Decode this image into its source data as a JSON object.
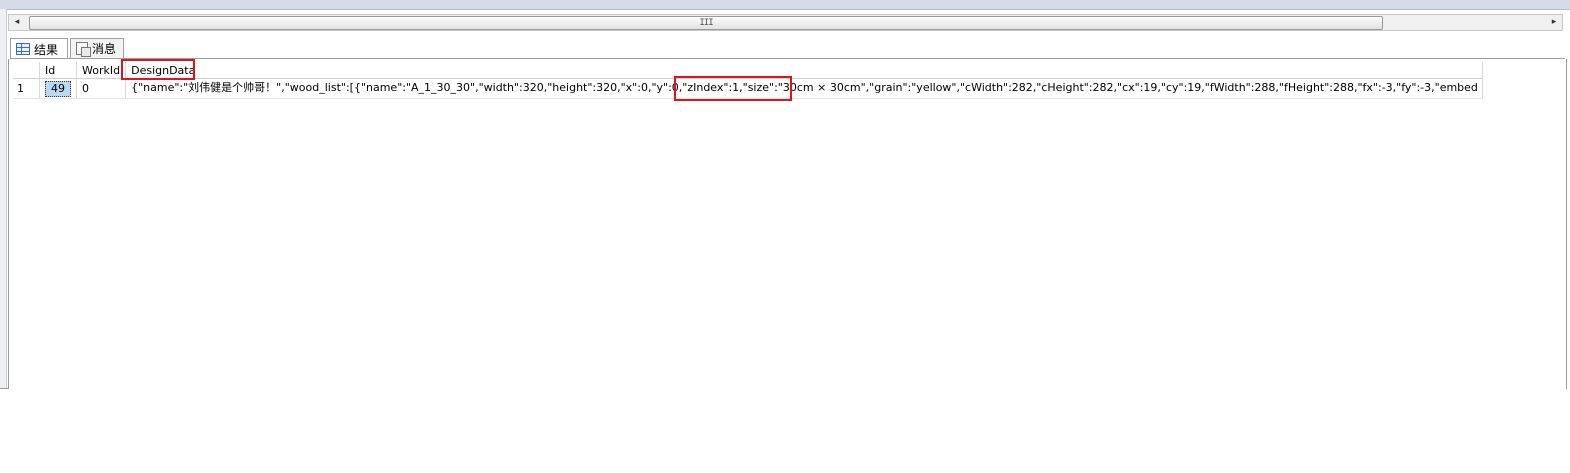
{
  "hscroll": {
    "left_arrow": "◂",
    "right_arrow": "▸",
    "grip": "III"
  },
  "tabs": [
    {
      "label": "结果",
      "icon": "grid-icon"
    },
    {
      "label": "消息",
      "icon": "message-icon"
    }
  ],
  "grid": {
    "columns": [
      "Id",
      "WorkId",
      "DesignData"
    ],
    "rows": [
      {
        "rownum": "1",
        "id": "49",
        "work_id": "0",
        "design_data": "{\"name\":\"刘伟健是个帅哥！\",\"wood_list\":[{\"name\":\"A_1_30_30\",\"width\":320,\"height\":320,\"x\":0,\"y\":0,\"zIndex\":1,\"size\":\"30cm × 30cm\",\"grain\":\"yellow\",\"cWidth\":282,\"cHeight\":282,\"cx\":19,\"cy\":19,\"fWidth\":288,\"fHeight\":288,\"fx\":-3,\"fy\":-3,\"embed_paper\":{\"cover\":false,\"width\"..."
      }
    ]
  },
  "highlight_color": "#e1141e",
  "selection_color": "#b8d8f3"
}
